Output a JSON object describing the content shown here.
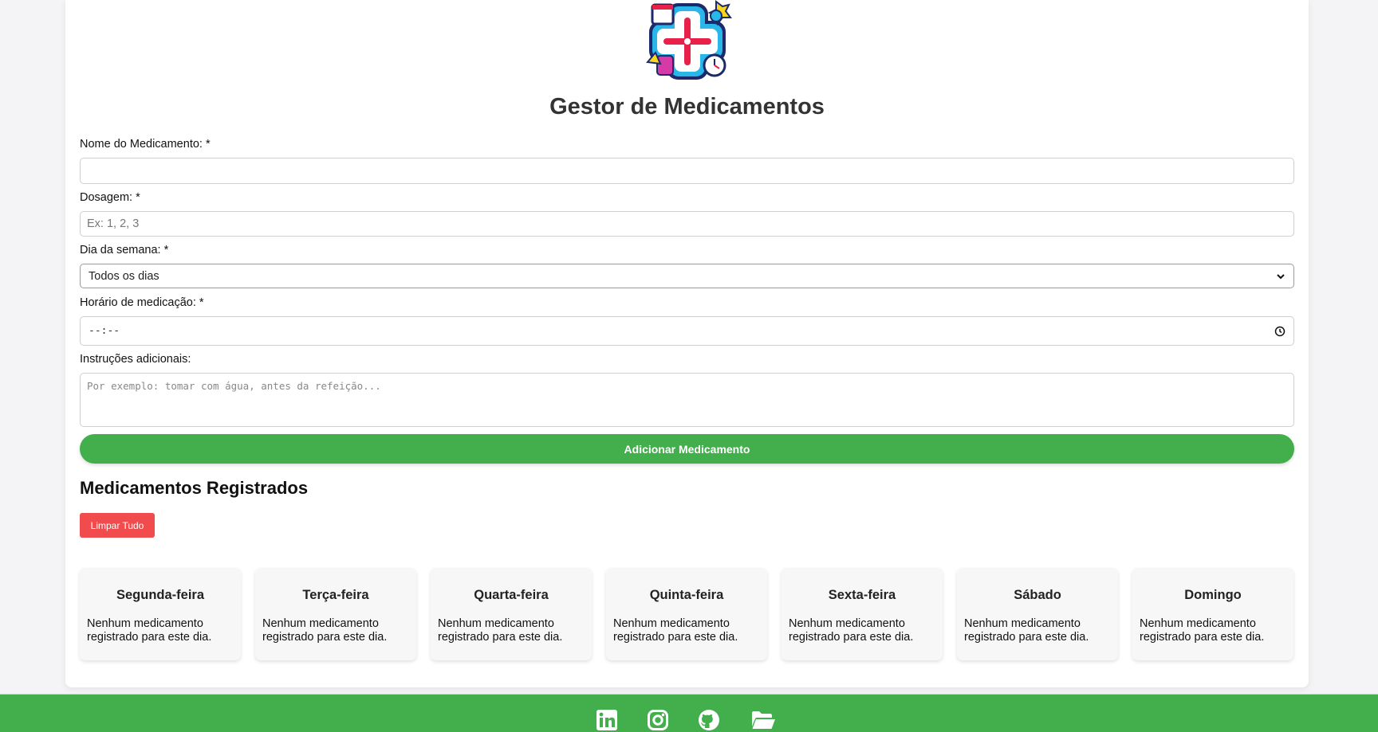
{
  "header": {
    "title": "Gestor de Medicamentos"
  },
  "form": {
    "name_label": "Nome do Medicamento: *",
    "name_value": "",
    "dosage_label": "Dosagem: *",
    "dosage_placeholder": "Ex: 1, 2, 3",
    "day_label": "Dia da semana: *",
    "day_selected": "Todos os dias",
    "time_label": "Horário de medicação: *",
    "time_value": "--:--",
    "instructions_label": "Instruções adicionais:",
    "instructions_placeholder": "Por exemplo: tomar com água, antes da refeição...",
    "submit_label": "Adicionar Medicamento"
  },
  "registered": {
    "title": "Medicamentos Registrados",
    "clear_label": "Limpar Tudo",
    "days": [
      {
        "name": "Segunda-feira",
        "empty": "Nenhum medicamento registrado para este dia."
      },
      {
        "name": "Terça-feira",
        "empty": "Nenhum medicamento registrado para este dia."
      },
      {
        "name": "Quarta-feira",
        "empty": "Nenhum medicamento registrado para este dia."
      },
      {
        "name": "Quinta-feira",
        "empty": "Nenhum medicamento registrado para este dia."
      },
      {
        "name": "Sexta-feira",
        "empty": "Nenhum medicamento registrado para este dia."
      },
      {
        "name": "Sábado",
        "empty": "Nenhum medicamento registrado para este dia."
      },
      {
        "name": "Domingo",
        "empty": "Nenhum medicamento registrado para este dia."
      }
    ]
  },
  "footer": {
    "icons": [
      "linkedin-icon",
      "instagram-icon",
      "github-icon",
      "folder-icon"
    ]
  },
  "colors": {
    "accent": "#43ae4c",
    "danger": "#f14b4d"
  }
}
